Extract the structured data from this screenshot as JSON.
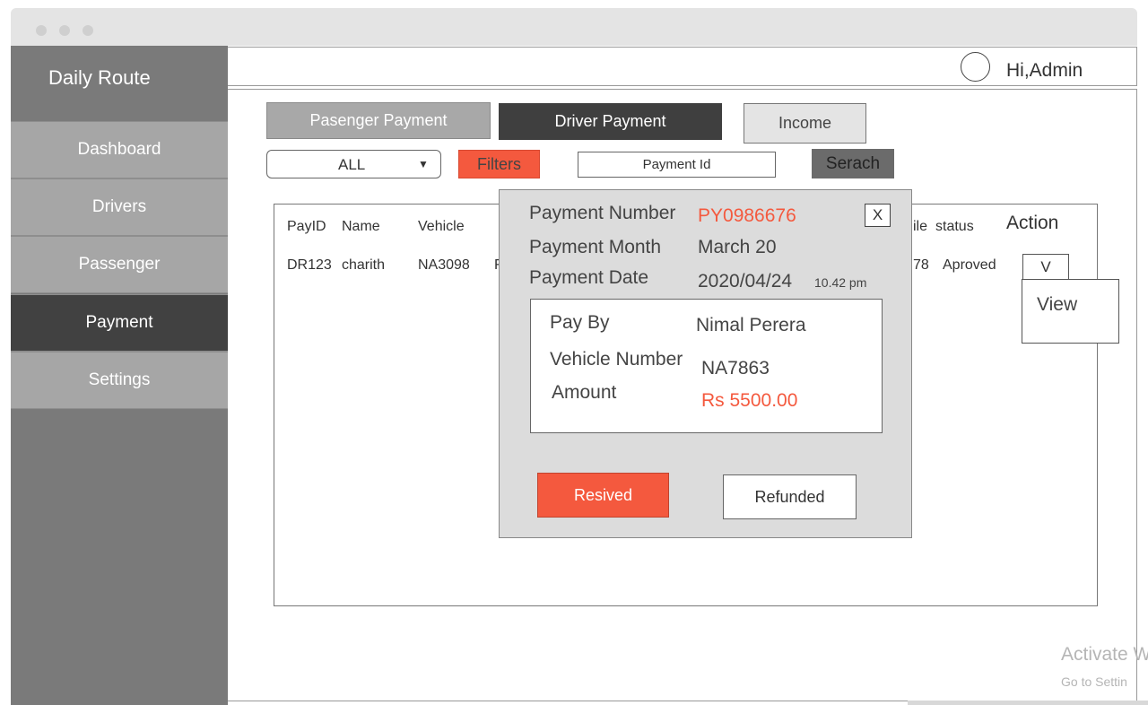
{
  "sidebar": {
    "brand": "Daily Route",
    "items": [
      {
        "label": "Dashboard"
      },
      {
        "label": "Drivers"
      },
      {
        "label": "Passenger"
      },
      {
        "label": "Payment"
      },
      {
        "label": "Settings"
      }
    ],
    "active_item": "Payment"
  },
  "header": {
    "greeting": "Hi,Admin"
  },
  "tabs": {
    "passenger": "Pasenger Payment",
    "driver": "Driver Payment",
    "income": "Income",
    "active_tab": "Driver Payment"
  },
  "filters": {
    "select_value": "ALL",
    "filters_label": "Filters",
    "search_placeholder": "Payment Id",
    "search_label": "Serach"
  },
  "table": {
    "headers": {
      "payid": "PayID",
      "name": "Name",
      "vehicle": "Vehicle",
      "mobile_partial": "ile",
      "status": "status",
      "action": "Action"
    },
    "rows": [
      {
        "payid": "DR123",
        "name": "charith",
        "vehicle": "NA3098",
        "hidden_partial": "F",
        "mobile_partial": "78",
        "status": "Aproved"
      }
    ],
    "action_button": "V",
    "action_menu_item": "View"
  },
  "modal": {
    "payment_number_label": "Payment Number",
    "payment_number": "PY0986676",
    "payment_month_label": "Payment Month",
    "payment_month": "March 20",
    "payment_date_label": "Payment Date",
    "payment_date": "2020/04/24",
    "payment_time": "10.42 pm",
    "close_label": "X",
    "pay_by_label": "Pay By",
    "pay_by": "Nimal Perera",
    "vehicle_number_label": "Vehicle Number",
    "vehicle_number": "NA7863",
    "amount_label": "Amount",
    "amount": "Rs 5500.00",
    "received_label": "Resived",
    "refunded_label": "Refunded"
  },
  "watermark": {
    "line1": "Activate W",
    "line2": "Go to Settin"
  },
  "colors": {
    "accent": "#f4593e",
    "sidebar_bg": "#7a7a7a",
    "nav_item_bg": "#a6a6a6",
    "nav_active_bg": "#414141",
    "modal_bg": "#dcdcdc"
  }
}
